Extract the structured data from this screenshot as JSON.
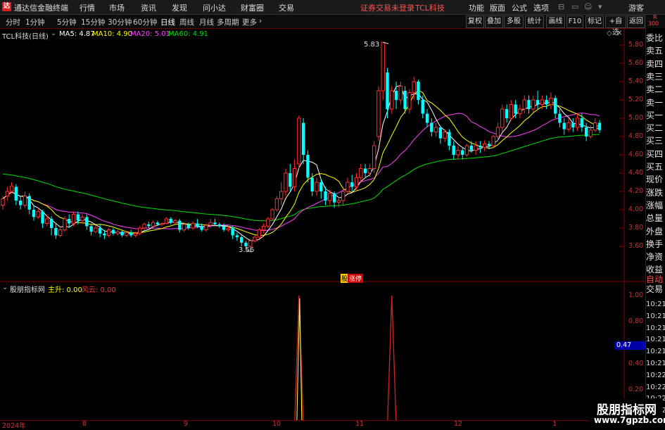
{
  "menu": {
    "app_title": "通达信金融终端",
    "logo_glyph": "达",
    "items": [
      "行情",
      "市场",
      "资讯",
      "发现",
      "问小达",
      "财富圈",
      "交易"
    ],
    "notice": "证券交易未登录",
    "stock": "TCL科技",
    "right_items": [
      "功能",
      "版面",
      "公式",
      "选项"
    ],
    "guest": "游客"
  },
  "toolbar": {
    "periods": [
      "分时",
      "1分钟",
      "5分钟",
      "15分钟",
      "30分钟",
      "60分钟",
      "日线",
      "周线",
      "月线",
      "多周期",
      "更多"
    ],
    "active_period": "日线",
    "buttons": [
      "复权",
      "叠加",
      "多股",
      "统计",
      "画线",
      "F10",
      "标记",
      "+自选",
      "返回"
    ],
    "corner_top": "R",
    "corner_bottom": "300"
  },
  "price_chart": {
    "title": "TCL科技(日线)",
    "ma": [
      {
        "label": "MA5: 4.87",
        "color": "#ffffff"
      },
      {
        "label": "MA10: 4.90",
        "color": "#ffff00"
      },
      {
        "label": "MA20: 5.01",
        "color": "#ff40ff"
      },
      {
        "label": "MA60: 4.91",
        "color": "#00e000"
      }
    ],
    "y_ticks": [
      "5.80",
      "5.60",
      "5.40",
      "5.20",
      "5.00",
      "4.80",
      "4.60",
      "4.40",
      "4.20",
      "4.00",
      "3.80",
      "3.60"
    ],
    "high_label": "5.83",
    "low_label": "3.56",
    "marker_prefix": "股",
    "marker_text": "涨停"
  },
  "indicator": {
    "title": "股朋指标网",
    "main_label": "主升: 0.00",
    "risk_label": "风云: 0.00",
    "y_ticks": [
      "1.00",
      "0.80",
      "0.60",
      "0.40",
      "0.20"
    ],
    "current_value": "0.47"
  },
  "right_panel": {
    "labels": [
      "委比",
      "卖五",
      "卖四",
      "卖三",
      "卖二",
      "卖一",
      "买一",
      "买二",
      "买三",
      "买四",
      "买五",
      "现价",
      "涨跌",
      "涨幅",
      "总量",
      "外盘",
      "换手",
      "净资",
      "收益"
    ],
    "trade_labels": [
      "自动",
      "交易"
    ],
    "times": [
      "10:21",
      "10:21",
      "10:21",
      "10:21",
      "10:21",
      "10:21",
      "10:22",
      "10:22",
      "10:22",
      "10:22"
    ]
  },
  "x_axis": {
    "labels": [
      "2024年",
      "8",
      "9",
      "10",
      "11",
      "12",
      "1"
    ]
  },
  "watermark": {
    "title": "股朋指标网",
    "url": "www.7gpzb.com"
  },
  "colors": {
    "up": "#ff3030",
    "down": "#00ffff",
    "ma5": "#ffffff",
    "ma10": "#ffff00",
    "ma20": "#ff40ff",
    "ma60": "#00e000",
    "divider": "#880000"
  },
  "chart_data": {
    "type": "candlestick",
    "title": "TCL科技(日线)",
    "ylim": [
      3.5,
      5.9
    ],
    "candles": [
      [
        4.05,
        4.12,
        4.0,
        4.15
      ],
      [
        4.15,
        4.2,
        4.1,
        4.25
      ],
      [
        4.2,
        4.26,
        4.18,
        4.3
      ],
      [
        4.25,
        4.1,
        4.05,
        4.28
      ],
      [
        4.1,
        4.05,
        4.0,
        4.15
      ],
      [
        4.05,
        4.15,
        4.02,
        4.2
      ],
      [
        4.15,
        4.0,
        3.95,
        4.18
      ],
      [
        4.0,
        3.92,
        3.88,
        4.05
      ],
      [
        3.92,
        3.98,
        3.9,
        4.02
      ],
      [
        3.98,
        3.85,
        3.8,
        4.0
      ],
      [
        3.85,
        3.9,
        3.82,
        3.95
      ],
      [
        3.9,
        3.8,
        3.72,
        3.93
      ],
      [
        3.8,
        3.72,
        3.68,
        3.85
      ],
      [
        3.72,
        3.78,
        3.7,
        3.82
      ],
      [
        3.78,
        3.9,
        3.76,
        3.93
      ],
      [
        3.9,
        3.85,
        3.8,
        3.95
      ],
      [
        3.85,
        3.95,
        3.82,
        3.98
      ],
      [
        3.95,
        3.88,
        3.84,
        3.98
      ],
      [
        3.88,
        3.92,
        3.85,
        3.95
      ],
      [
        3.92,
        3.82,
        3.78,
        3.95
      ],
      [
        3.82,
        3.76,
        3.72,
        3.85
      ],
      [
        3.76,
        3.8,
        3.74,
        3.83
      ],
      [
        3.8,
        3.74,
        3.7,
        3.84
      ],
      [
        3.74,
        3.72,
        3.68,
        3.78
      ],
      [
        3.72,
        3.78,
        3.7,
        3.8
      ],
      [
        3.78,
        3.74,
        3.72,
        3.8
      ],
      [
        3.74,
        3.76,
        3.72,
        3.78
      ],
      [
        3.76,
        3.72,
        3.7,
        3.78
      ],
      [
        3.72,
        3.75,
        3.7,
        3.77
      ],
      [
        3.75,
        3.72,
        3.7,
        3.78
      ],
      [
        3.72,
        3.74,
        3.7,
        3.76
      ],
      [
        3.74,
        3.8,
        3.72,
        3.82
      ],
      [
        3.8,
        3.84,
        3.78,
        3.86
      ],
      [
        3.84,
        3.82,
        3.8,
        3.87
      ],
      [
        3.82,
        3.86,
        3.8,
        3.88
      ],
      [
        3.86,
        3.84,
        3.82,
        3.88
      ],
      [
        3.84,
        3.85,
        3.82,
        3.86
      ],
      [
        3.85,
        3.9,
        3.84,
        3.92
      ],
      [
        3.9,
        3.86,
        3.84,
        3.92
      ],
      [
        3.86,
        3.88,
        3.84,
        3.9
      ],
      [
        3.88,
        3.78,
        3.75,
        3.9
      ],
      [
        3.78,
        3.84,
        3.76,
        3.86
      ],
      [
        3.84,
        3.8,
        3.78,
        3.86
      ],
      [
        3.8,
        3.85,
        3.78,
        3.87
      ],
      [
        3.85,
        3.82,
        3.8,
        3.9
      ],
      [
        3.82,
        3.78,
        3.76,
        3.85
      ],
      [
        3.78,
        3.83,
        3.76,
        3.85
      ],
      [
        3.83,
        3.86,
        3.8,
        3.9
      ],
      [
        3.86,
        3.84,
        3.82,
        3.9
      ],
      [
        3.84,
        3.82,
        3.8,
        3.86
      ],
      [
        3.82,
        3.78,
        3.76,
        3.85
      ],
      [
        3.78,
        3.8,
        3.76,
        3.82
      ],
      [
        3.8,
        3.72,
        3.68,
        3.82
      ],
      [
        3.72,
        3.7,
        3.66,
        3.75
      ],
      [
        3.7,
        3.64,
        3.6,
        3.72
      ],
      [
        3.64,
        3.6,
        3.56,
        3.66
      ],
      [
        3.6,
        3.66,
        3.58,
        3.68
      ],
      [
        3.66,
        3.7,
        3.64,
        3.72
      ],
      [
        3.7,
        3.78,
        3.68,
        3.8
      ],
      [
        3.78,
        3.82,
        3.74,
        3.85
      ],
      [
        3.82,
        3.9,
        3.8,
        3.92
      ],
      [
        3.9,
        4.0,
        3.88,
        4.02
      ],
      [
        4.0,
        4.12,
        3.98,
        4.15
      ],
      [
        4.12,
        4.2,
        4.05,
        4.3
      ],
      [
        4.2,
        4.4,
        4.15,
        4.45
      ],
      [
        4.4,
        4.25,
        4.2,
        4.5
      ],
      [
        4.25,
        4.45,
        4.2,
        4.55
      ],
      [
        4.5,
        5.0,
        4.45,
        5.03
      ],
      [
        4.95,
        4.6,
        4.5,
        5.0
      ],
      [
        4.6,
        4.35,
        4.3,
        4.65
      ],
      [
        4.35,
        4.2,
        4.15,
        4.4
      ],
      [
        4.2,
        4.3,
        4.15,
        4.35
      ],
      [
        4.3,
        4.2,
        4.12,
        4.34
      ],
      [
        4.2,
        4.1,
        4.05,
        4.25
      ],
      [
        4.1,
        4.18,
        4.05,
        4.22
      ],
      [
        4.18,
        4.08,
        4.02,
        4.2
      ],
      [
        4.08,
        4.1,
        4.03,
        4.14
      ],
      [
        4.1,
        4.2,
        4.05,
        4.25
      ],
      [
        4.2,
        4.3,
        4.18,
        4.35
      ],
      [
        4.3,
        4.25,
        4.2,
        4.38
      ],
      [
        4.25,
        4.35,
        4.22,
        4.4
      ],
      [
        4.35,
        4.45,
        4.3,
        4.5
      ],
      [
        4.45,
        4.4,
        4.35,
        4.5
      ],
      [
        4.4,
        4.45,
        4.36,
        4.5
      ],
      [
        4.45,
        4.7,
        4.4,
        4.75
      ],
      [
        4.8,
        5.3,
        4.75,
        5.35
      ],
      [
        5.3,
        5.83,
        5.2,
        5.83
      ],
      [
        5.5,
        5.1,
        5.0,
        5.55
      ],
      [
        5.1,
        5.3,
        5.05,
        5.35
      ],
      [
        5.3,
        5.2,
        5.1,
        5.4
      ],
      [
        5.2,
        5.35,
        5.15,
        5.4
      ],
      [
        5.3,
        5.1,
        5.05,
        5.35
      ],
      [
        5.1,
        5.28,
        5.05,
        5.32
      ],
      [
        5.28,
        5.4,
        5.2,
        5.45
      ],
      [
        5.4,
        5.2,
        5.15,
        5.42
      ],
      [
        5.2,
        5.05,
        5.0,
        5.25
      ],
      [
        5.05,
        4.95,
        4.9,
        5.1
      ],
      [
        4.95,
        4.85,
        4.8,
        5.0
      ],
      [
        4.85,
        4.9,
        4.8,
        4.95
      ],
      [
        4.9,
        4.78,
        4.72,
        4.92
      ],
      [
        4.78,
        4.85,
        4.74,
        4.88
      ],
      [
        4.85,
        4.7,
        4.65,
        4.88
      ],
      [
        4.7,
        4.6,
        4.55,
        4.75
      ],
      [
        4.6,
        4.65,
        4.55,
        4.7
      ],
      [
        4.65,
        4.6,
        4.55,
        4.68
      ],
      [
        4.6,
        4.7,
        4.58,
        4.72
      ],
      [
        4.7,
        4.65,
        4.62,
        4.75
      ],
      [
        4.65,
        4.7,
        4.6,
        4.75
      ],
      [
        4.7,
        4.68,
        4.62,
        4.75
      ],
      [
        4.68,
        4.72,
        4.64,
        4.76
      ],
      [
        4.72,
        4.7,
        4.66,
        4.75
      ],
      [
        4.7,
        4.8,
        4.68,
        4.82
      ],
      [
        4.8,
        4.9,
        4.75,
        4.95
      ],
      [
        4.9,
        5.1,
        4.85,
        5.15
      ],
      [
        5.1,
        5.0,
        4.95,
        5.15
      ],
      [
        5.0,
        5.15,
        4.98,
        5.2
      ],
      [
        5.15,
        5.05,
        5.0,
        5.2
      ],
      [
        5.05,
        5.1,
        5.0,
        5.15
      ],
      [
        5.1,
        5.2,
        5.05,
        5.25
      ],
      [
        5.2,
        5.1,
        5.05,
        5.25
      ],
      [
        5.1,
        5.2,
        5.06,
        5.25
      ],
      [
        5.2,
        5.15,
        5.1,
        5.3
      ],
      [
        5.15,
        5.2,
        5.1,
        5.25
      ],
      [
        5.2,
        5.15,
        5.1,
        5.25
      ],
      [
        5.15,
        5.22,
        5.1,
        5.28
      ],
      [
        5.22,
        5.05,
        5.0,
        5.25
      ],
      [
        5.05,
        4.95,
        4.9,
        5.1
      ],
      [
        4.95,
        4.88,
        4.82,
        5.0
      ],
      [
        4.88,
        4.95,
        4.85,
        5.0
      ],
      [
        4.95,
        4.9,
        4.85,
        5.0
      ],
      [
        4.9,
        5.0,
        4.86,
        5.05
      ],
      [
        5.0,
        4.9,
        4.85,
        5.05
      ],
      [
        4.9,
        4.8,
        4.75,
        4.95
      ],
      [
        4.8,
        4.87,
        4.78,
        4.92
      ],
      [
        4.87,
        4.95,
        4.85,
        5.0
      ],
      [
        4.95,
        4.87,
        4.84,
        4.98
      ]
    ],
    "indicator_spikes": [
      {
        "index": 67,
        "value": 1.0
      },
      {
        "index": 88,
        "value": 1.0
      }
    ]
  }
}
